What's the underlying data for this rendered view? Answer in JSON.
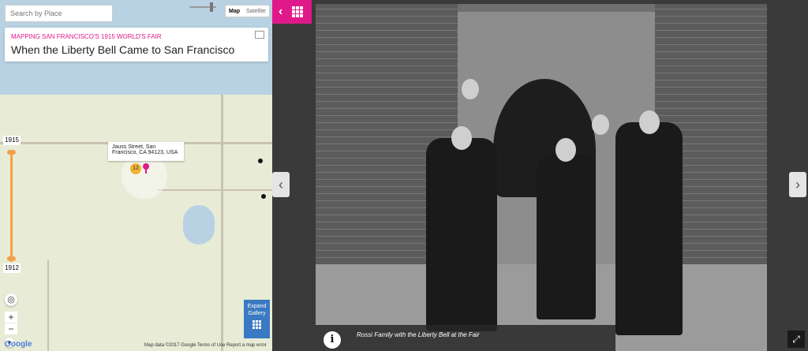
{
  "map": {
    "search_placeholder": "Search by Place",
    "maptype": {
      "map_label": "Map",
      "satellite_label": "Satellite"
    },
    "card": {
      "subtitle": "MAPPING SAN FRANCISCO'S 1915 WORLD'S FAIR",
      "title": "When the Liberty Bell Came to San Francisco"
    },
    "timeline": {
      "top_year": "1915",
      "bottom_year": "1912"
    },
    "popup_address": "Jauss Street, San Francisco, CA 94123, USA",
    "cluster_count": "12",
    "expand_gallery_label": "Expand Gallery",
    "footer": "Map data ©2017 Google   Terms of Use   Report a map error",
    "google_logo": "Google"
  },
  "viewer": {
    "caption": "Rossi Family with the Liberty Bell at the Fair",
    "info_icon": "i",
    "prev_icon": "chevron-left-icon",
    "next_icon": "chevron-right-icon"
  },
  "colors": {
    "accent": "#e0198a",
    "gallery_blue": "#3b79c2",
    "timeline": "#f2a24c"
  }
}
